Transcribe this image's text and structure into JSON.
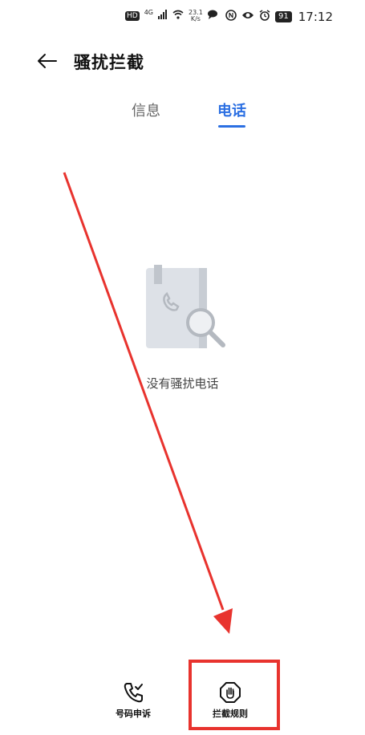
{
  "status_bar": {
    "hd": "HD",
    "network": "4G",
    "speed_value": "23.1",
    "speed_unit": "K/s",
    "battery": "91",
    "time": "17:12"
  },
  "header": {
    "title": "骚扰拦截"
  },
  "tabs": [
    {
      "label": "信息"
    },
    {
      "label": "电话"
    }
  ],
  "empty_state": {
    "text": "没有骚扰电话"
  },
  "bottom_bar": {
    "appeal_label": "号码申诉",
    "rules_label": "拦截规则"
  },
  "colors": {
    "accent": "#2b6fe2",
    "annotation": "#e8332e"
  }
}
